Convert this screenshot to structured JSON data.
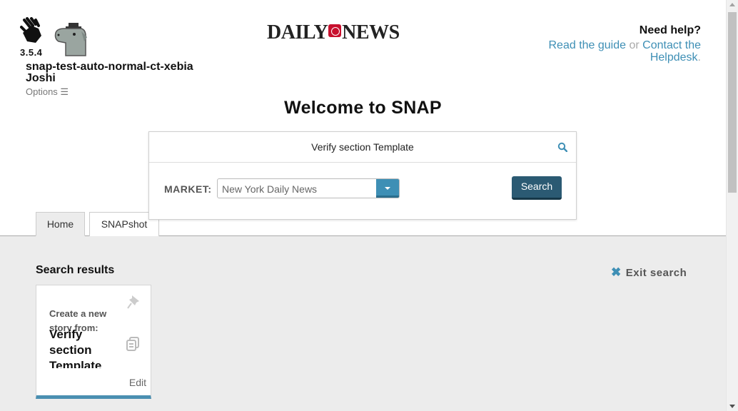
{
  "app": {
    "version": "3.5.4",
    "user_name": "snap-test-auto-normal-ct-xebia Joshi",
    "options_label": "Options ☰",
    "brand_left": "DAILY",
    "brand_right": "NEWS"
  },
  "help": {
    "title": "Need help?",
    "guide_link": "Read the guide",
    "or": "or",
    "helpdesk_link": "Contact the Helpdesk",
    "trailing": "."
  },
  "welcome": "Welcome to SNAP",
  "search": {
    "query": "Verify section Template",
    "market_label": "MARKET:",
    "market_value": "New York Daily News",
    "button_label": "Search"
  },
  "tabs": [
    {
      "label": "Home",
      "active": true
    },
    {
      "label": "SNAPshot",
      "active": false
    }
  ],
  "results": {
    "title": "Search results",
    "exit_label": "Exit search",
    "cards": [
      {
        "create_text": "Create a new story from:",
        "title": "Verify section Template",
        "edit_label": "Edit"
      }
    ]
  },
  "colors": {
    "accent": "#3e8fb5",
    "button": "#2b5a73",
    "brand_red": "#c8102e",
    "panel_bg": "#ececec"
  },
  "icons": [
    "hand-logo-icon",
    "dog-logo-icon",
    "search-icon",
    "dropdown-caret-icon",
    "close-x-icon",
    "pin-icon",
    "copy-icon"
  ]
}
